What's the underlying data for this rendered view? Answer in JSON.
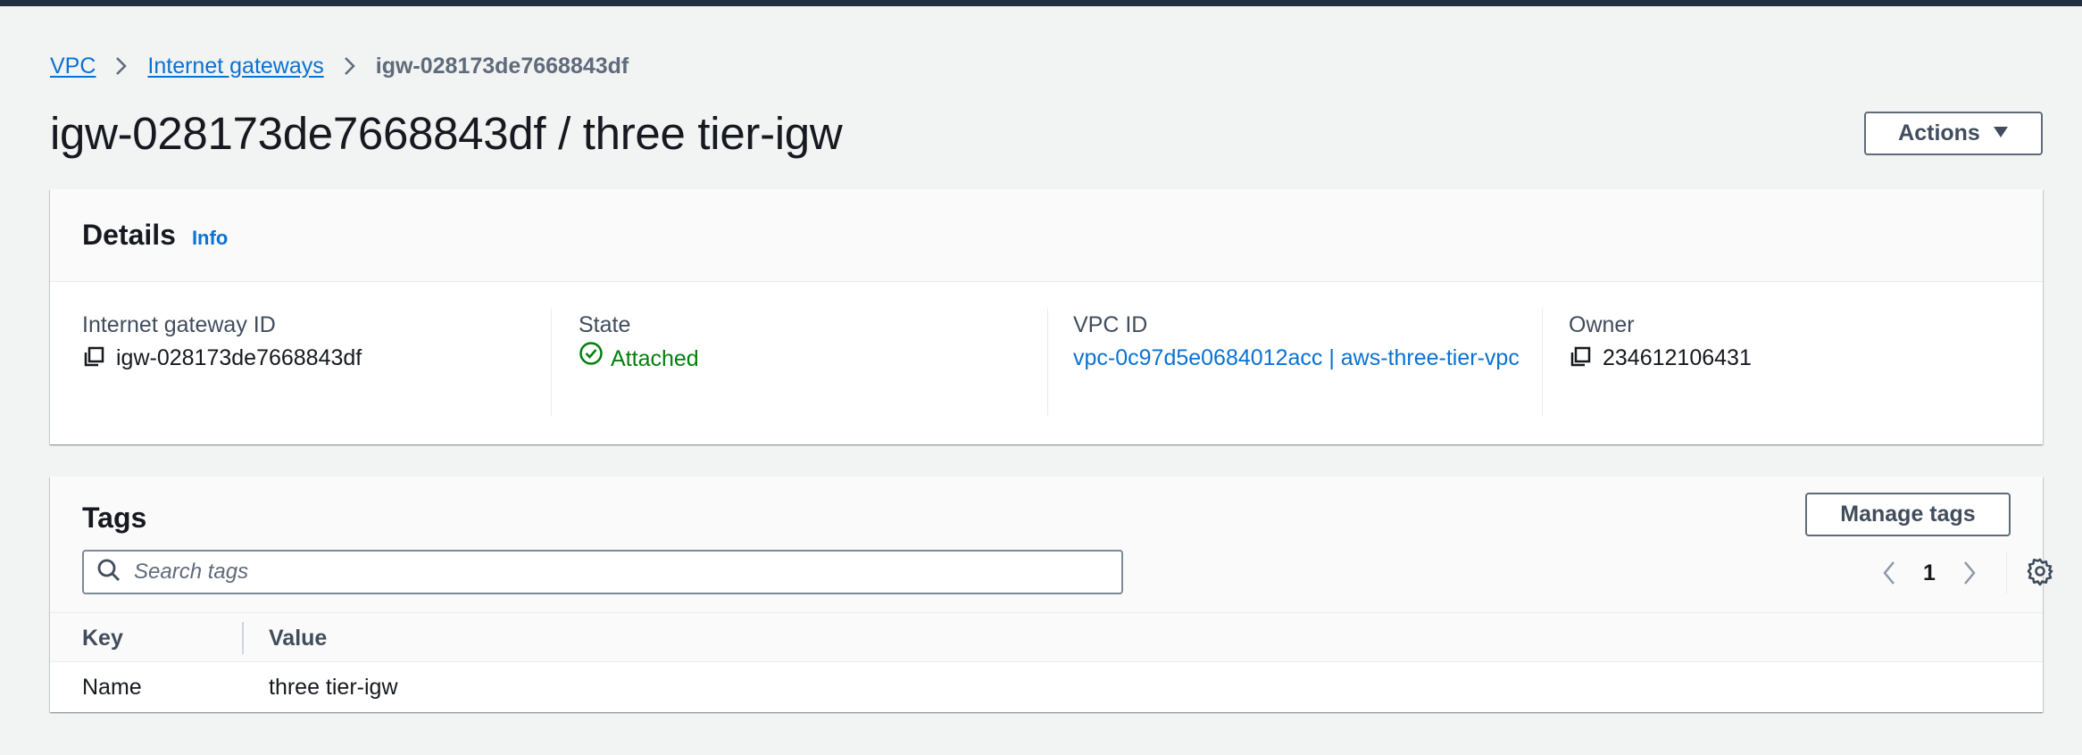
{
  "breadcrumb": {
    "items": [
      "VPC",
      "Internet gateways"
    ],
    "current": "igw-028173de7668843df"
  },
  "page": {
    "title": "igw-028173de7668843df / three tier-igw",
    "actions_label": "Actions"
  },
  "details": {
    "title": "Details",
    "info_label": "Info",
    "fields": {
      "igw_id": {
        "label": "Internet gateway ID",
        "value": "igw-028173de7668843df"
      },
      "state": {
        "label": "State",
        "value": "Attached"
      },
      "vpc_id": {
        "label": "VPC ID",
        "value": "vpc-0c97d5e0684012acc | aws-three-tier-vpc"
      },
      "owner": {
        "label": "Owner",
        "value": "234612106431"
      }
    }
  },
  "tags": {
    "title": "Tags",
    "manage_label": "Manage tags",
    "search_placeholder": "Search tags",
    "page": "1",
    "columns": {
      "key": "Key",
      "value": "Value"
    },
    "rows": [
      {
        "key": "Name",
        "value": "three tier-igw"
      }
    ]
  },
  "colors": {
    "link": "#0972d3",
    "success": "#037f0c",
    "topbar": "#232f3e",
    "background": "#f2f3f3"
  },
  "icons": [
    "chevron-right-icon",
    "caret-down-icon",
    "copy-icon",
    "status-success-icon",
    "search-icon",
    "angle-left-icon",
    "angle-right-icon",
    "settings-icon"
  ]
}
